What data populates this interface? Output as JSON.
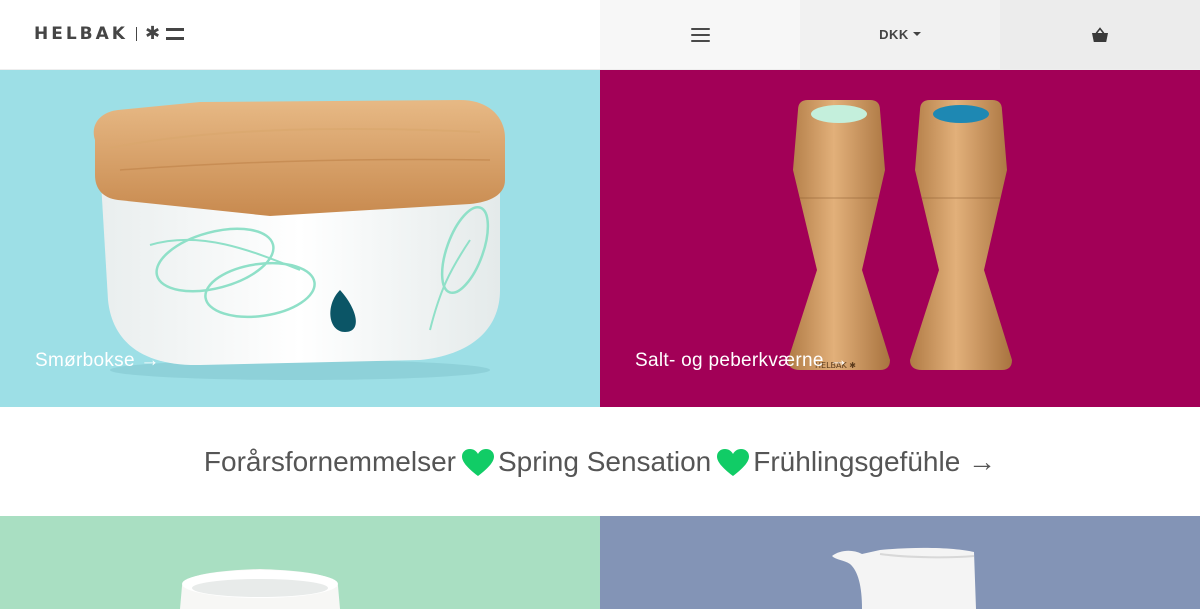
{
  "header": {
    "logo_text": "HELBAK",
    "logo_icon": "helbak-star-equals-mark",
    "menu_icon": "hamburger-icon",
    "currency": "DKK",
    "cart_icon": "basket-icon"
  },
  "tiles": [
    {
      "label": "Smørbokse →",
      "product": "butter-dish",
      "background": "#9ddfe6"
    },
    {
      "label": "Salt- og peberkværne →",
      "product": "salt-and-pepper-mills",
      "background": "#a20057",
      "engraving": "HELBAK ✱"
    },
    {
      "label": "",
      "product": "cup",
      "background": "#a9dfc2"
    },
    {
      "label": "",
      "product": "jug",
      "background": "#8394b6"
    }
  ],
  "banner": {
    "part1": "Forårsfornemmelser",
    "part2": "Spring Sensation",
    "part3": "Frühlingsgefühle →",
    "heart_color": "#11cc66"
  },
  "colors": {
    "text": "#555555",
    "logo": "#454545"
  }
}
